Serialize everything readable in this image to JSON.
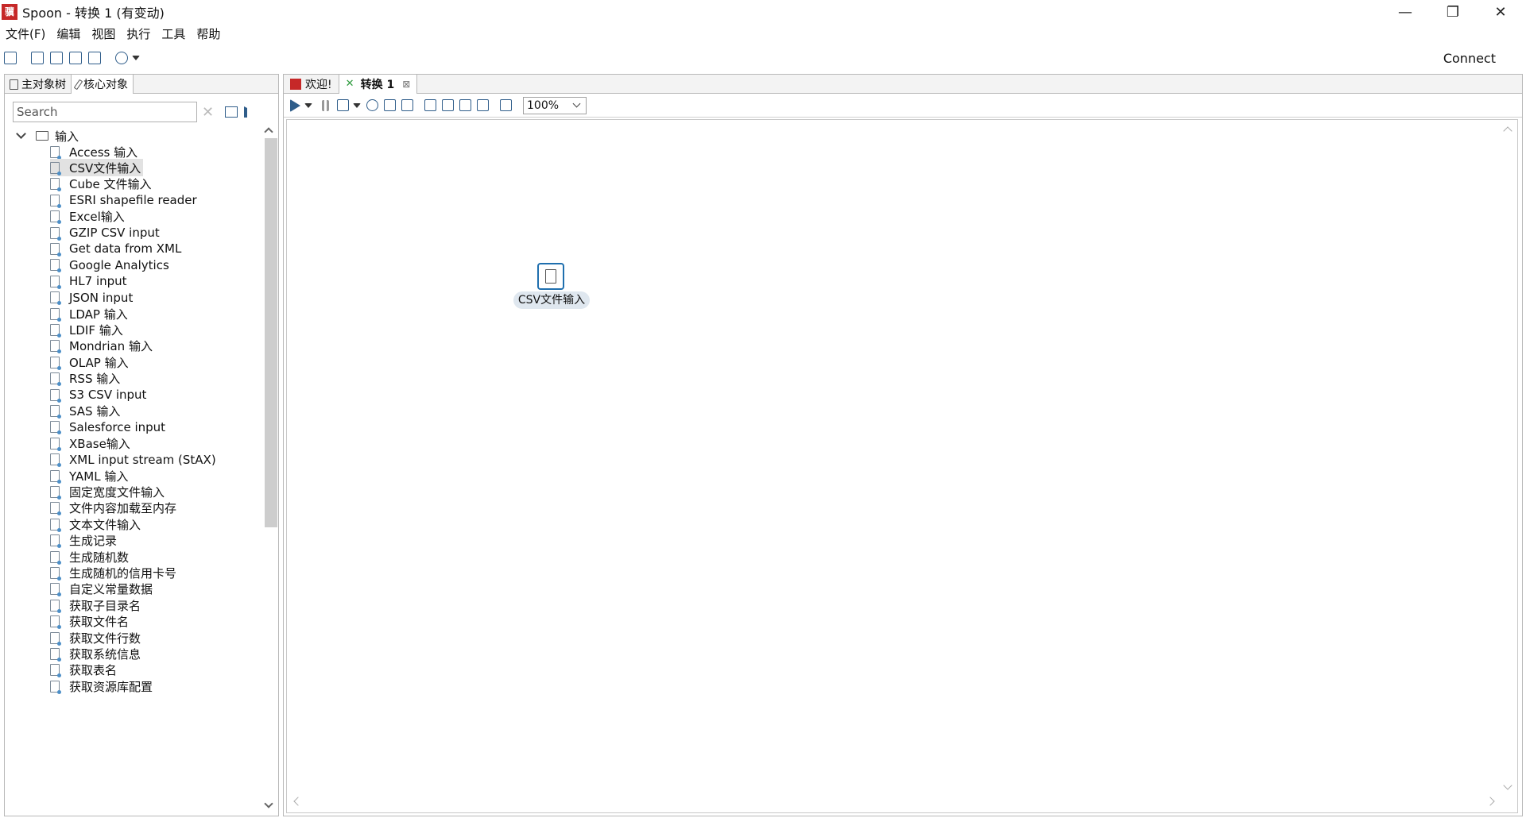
{
  "window": {
    "title": "Spoon - 转换 1 (有变动)",
    "app_icon_glyph": "骥",
    "minimize_glyph": "—",
    "maximize_glyph": "❐",
    "close_glyph": "✕"
  },
  "menu": [
    "文件(F)",
    "编辑",
    "视图",
    "执行",
    "工具",
    "帮助"
  ],
  "toolbar": {
    "connect_label": "Connect",
    "icons": [
      "new-file-icon",
      "open-file-icon",
      "explore-repository-icon",
      "save-icon",
      "save-as-icon",
      "perspective-layers-icon"
    ]
  },
  "left_panel": {
    "tabs": [
      {
        "label": "主对象树",
        "icon": "document-icon"
      },
      {
        "label": "核心对象",
        "icon": "pencil-icon"
      }
    ],
    "search": {
      "placeholder": "Search",
      "value": ""
    },
    "tree": {
      "root_label": "输入",
      "items": [
        "Access 输入",
        "CSV文件输入",
        "Cube 文件输入",
        "ESRI shapefile reader",
        "Excel输入",
        "GZIP CSV input",
        "Get data from XML",
        "Google Analytics",
        "HL7 input",
        "JSON input",
        "LDAP 输入",
        "LDIF 输入",
        "Mondrian 输入",
        "OLAP 输入",
        "RSS 输入",
        "S3 CSV input",
        "SAS 输入",
        "Salesforce input",
        "XBase输入",
        "XML input stream (StAX)",
        "YAML 输入",
        "固定宽度文件输入",
        "文件内容加载至内存",
        "文本文件输入",
        "生成记录",
        "生成随机数",
        "生成随机的信用卡号",
        "自定义常量数据",
        "获取子目录名",
        "获取文件名",
        "获取文件行数",
        "获取系统信息",
        "获取表名",
        "获取资源库配置"
      ],
      "selected_item": "CSV文件输入"
    }
  },
  "editor": {
    "tabs": [
      {
        "label": "欢迎!",
        "icon": "spoon-welcome-icon",
        "active": false
      },
      {
        "label": "转换 1",
        "icon": "transformation-icon",
        "active": true,
        "close_glyph": "⊠"
      }
    ],
    "zoom": "100%",
    "canvas_steps": [
      {
        "label": "CSV文件输入",
        "icon": "csv-file-input-icon"
      }
    ]
  },
  "colors": {
    "accent": "#1f6fae",
    "app_red": "#c62828",
    "selection": "#e2e2e2",
    "step_label_bg": "#dfe7ef"
  }
}
